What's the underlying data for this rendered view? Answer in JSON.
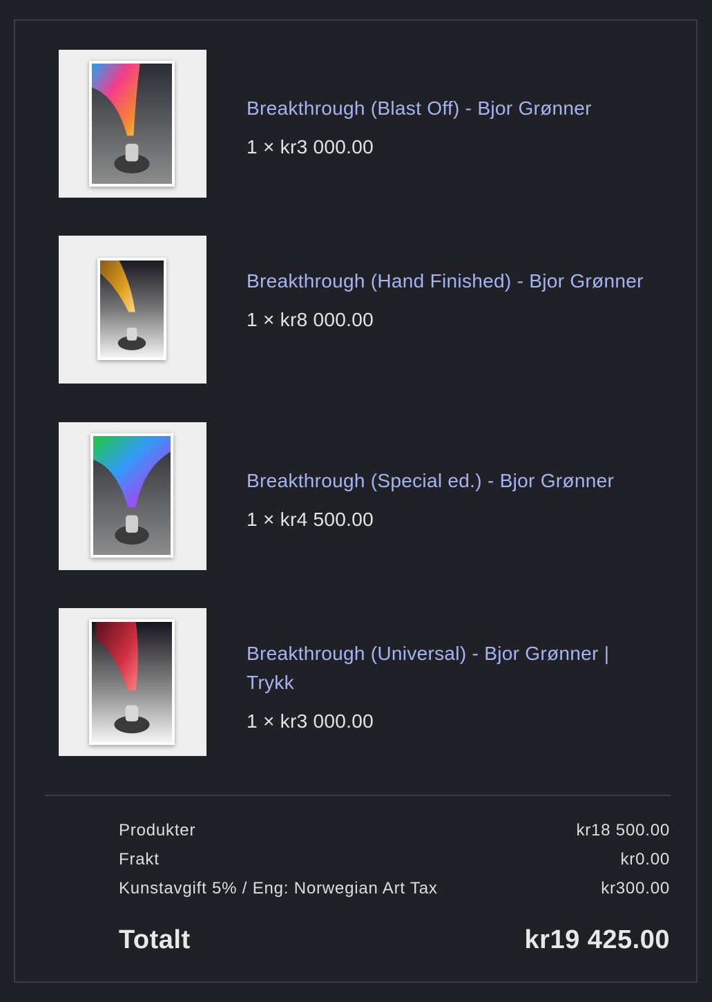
{
  "cart": {
    "items": [
      {
        "title": "Breakthrough (Blast Off) - Bjor Grønner",
        "quantity_price": "1 × kr3 000.00",
        "image": "artwork-blast-off"
      },
      {
        "title": "Breakthrough (Hand Finished) - Bjor Grønner",
        "quantity_price": "1 × kr8 000.00",
        "image": "artwork-hand-finished"
      },
      {
        "title": "Breakthrough (Special ed.) - Bjor Grønner",
        "quantity_price": "1 × kr4 500.00",
        "image": "artwork-special-ed"
      },
      {
        "title": "Breakthrough (Universal) - Bjor Grønner | Trykk",
        "quantity_price": "1 × kr3 000.00",
        "image": "artwork-universal"
      }
    ]
  },
  "summary": {
    "products_label": "Produkter",
    "products_value": "kr18 500.00",
    "shipping_label": "Frakt",
    "shipping_value": "kr0.00",
    "tax_label": "Kunstavgift 5% / Eng: Norwegian Art Tax",
    "tax_value": "kr300.00",
    "total_label": "Totalt",
    "total_value": "kr19 425.00"
  },
  "colors": {
    "background": "#1f2126",
    "link": "#a6b5f2",
    "text": "#e4e4e4"
  }
}
